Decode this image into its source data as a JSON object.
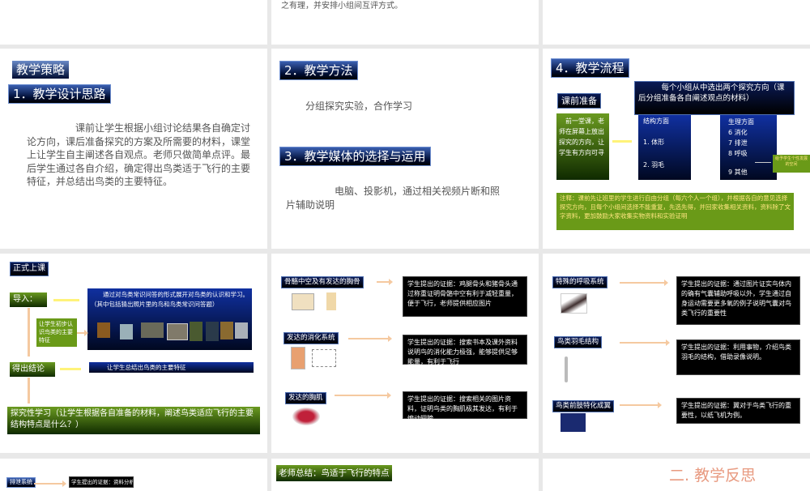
{
  "top_row": {
    "slide2_text": "之有理，并安排小组间互评方式。"
  },
  "slide_strategy": {
    "title": "教学策略",
    "heading": "1．教学设计思路",
    "body": "　　　　　课前让学生根据小组讨论结果各自确定讨论方向，课后准备探究的方案及所需要的材料，课堂上让学生自主阐述各自观点。老师只做简单点评。最后学生通过各自介绍，确定得出鸟类适于飞行的主要特征，并总结出鸟类的主要特征。"
  },
  "slide_methods": {
    "heading2": "2．教学方法",
    "text2": "分组探究实验，合作学习",
    "heading3": "3．教学媒体的选择与运用",
    "text3": "　　　　　电脑、投影机，通过相关视频片断和照片辅助说明"
  },
  "slide_flow": {
    "heading": "4．教学流程",
    "prep_label": "课前准备",
    "prep_box": "　前一堂课，老师在屏幕上放出探究的方向，让学生有方向可寻",
    "choose_box": "　　　每个小组从中选出两个探究方向（课后分组准备各自阐述观点的材料）",
    "col1": [
      "结构方面",
      "1. 体形",
      "2. 羽毛"
    ],
    "col2": [
      "生理方面",
      "6  消化",
      "7  排泄",
      "8  呼吸",
      "9 其他"
    ],
    "side_note": "给予学生个性发展的空间",
    "note": "注释：课前先让班里的学生进行自由分组（每六个人一个组），并根据各自的意见选择探究方向，且每个小组间选择不能重复，先选先得，并回家收集相关资料，资料除了文字资料，更加鼓励大家收集实物资料和实验证明"
  },
  "slide_class": {
    "title": "正式上课",
    "intro": "导入：",
    "intro_box": "　　通过对鸟类常识问答的形式展开对鸟类的认识和学习。（其中包括猜出照片里的鸟和鸟类常识问答题）",
    "side_box": "让学生初步认识鸟类的主要特征",
    "conclusion": "得出结论",
    "conclusion_box": "让学生总结出鸟类的主要特征",
    "inquiry": "探究性学习（让学生根据各自准备的材料，阐述鸟类适应飞行的主要结构特点是什么？）"
  },
  "slide_evidence1": {
    "items": [
      {
        "label": "骨骼中空及有发达的胸骨",
        "evidence": "学生提出的证据：鸡腿骨头和猪骨头通过称重证明骨骼中空有利于减轻重量，便于飞行，老师提供相应图片"
      },
      {
        "label": "发达的消化系统",
        "evidence": "学生提出的证据：搜索书本及课外资料说明鸟的消化能力极强，能够提供足够能量，有利于飞行"
      },
      {
        "label": "发达的胸肌",
        "evidence": "学生提出的证据：搜索相关的图片资料，证明鸟类的胸肌极其发达，有利于煽动翅膀"
      }
    ]
  },
  "slide_evidence2": {
    "items": [
      {
        "label": "特殊的呼吸系统",
        "evidence": "学生提出的证据：通过图片证实鸟体内的确有气囊辅助呼吸以外，学生通过自身运动需要更多氧的例子说明气囊对鸟类飞行的重要性"
      },
      {
        "label": "鸟类羽毛结构",
        "evidence": "学生提出的证据：利用事物，介绍鸟类羽毛的结构，借助录像说明。"
      },
      {
        "label": "鸟类前肢特化成翼",
        "evidence": "学生提出的证据：翼对于鸟类飞行的重要性，以纸飞机为例。"
      }
    ]
  },
  "bottom_row": {
    "excretion_label": "排泄系统",
    "excretion_evidence": "学生提出的证据：资料分析和实地",
    "summary": "老师总结：鸟适于飞行的特点",
    "reflection": "二. 教学反思"
  }
}
